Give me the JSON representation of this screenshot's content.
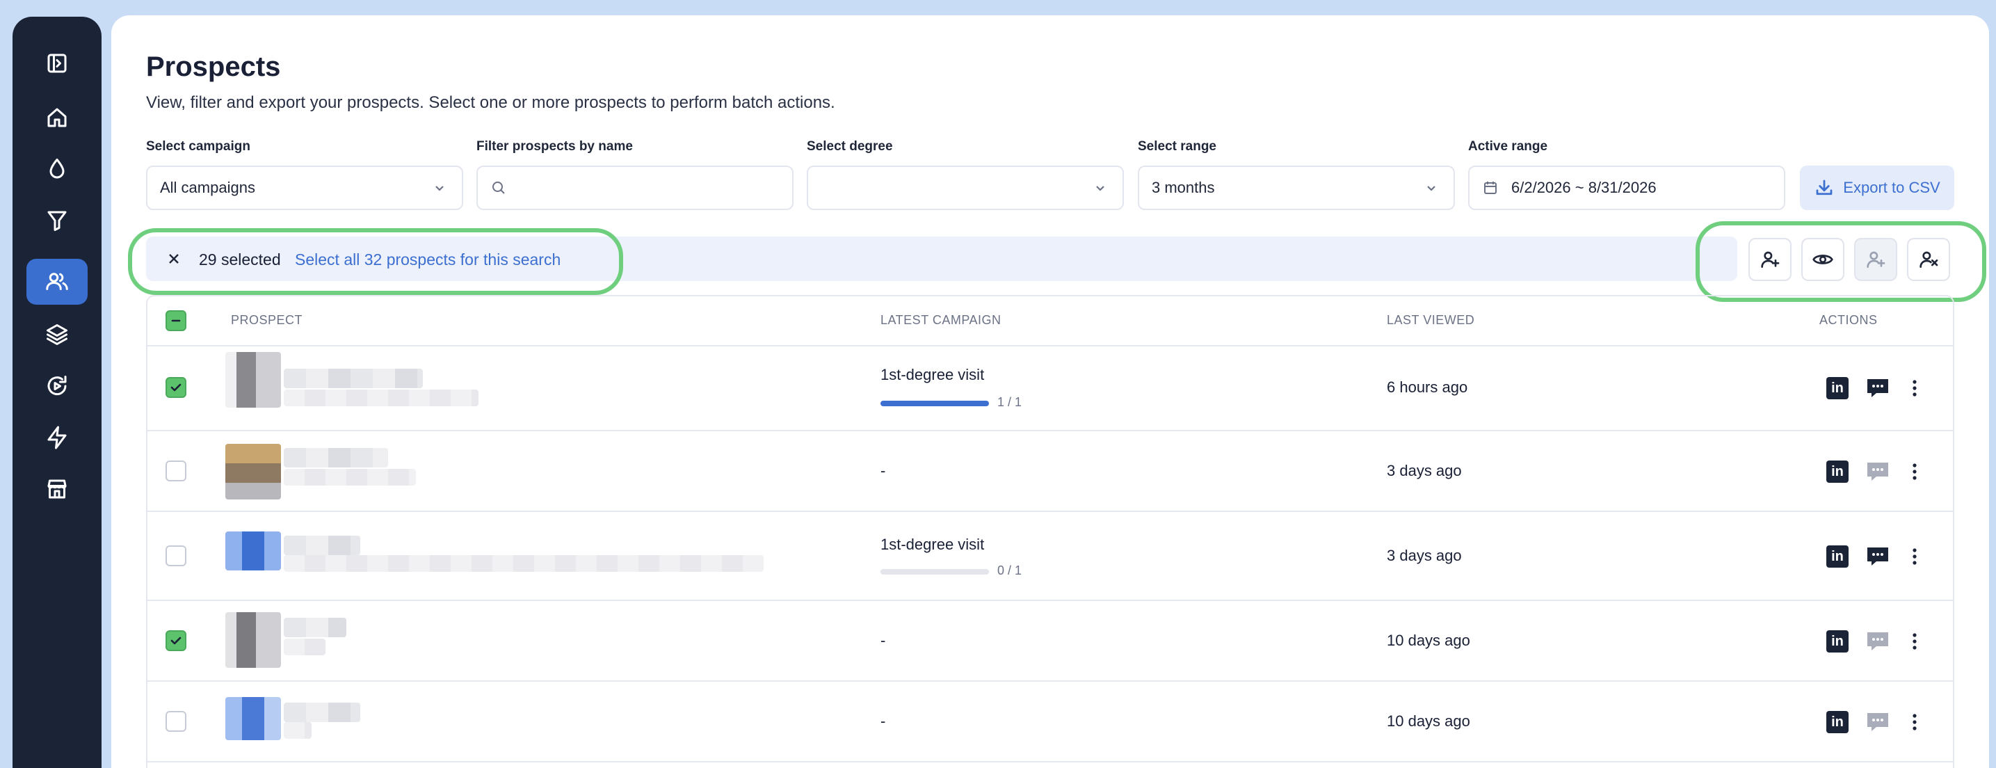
{
  "sidebar": {
    "items": [
      {
        "name": "sidebar-toggle",
        "icon": "panel-toggle-icon"
      },
      {
        "name": "home",
        "icon": "home-icon"
      },
      {
        "name": "drop",
        "icon": "drop-icon"
      },
      {
        "name": "funnel",
        "icon": "funnel-icon"
      },
      {
        "name": "prospects",
        "icon": "users-icon",
        "active": true
      },
      {
        "name": "layers",
        "icon": "layers-icon"
      },
      {
        "name": "refresh",
        "icon": "refresh-icon"
      },
      {
        "name": "bolt",
        "icon": "bolt-icon"
      },
      {
        "name": "store",
        "icon": "store-icon"
      }
    ]
  },
  "page": {
    "title": "Prospects",
    "subtitle": "View, filter and export your prospects. Select one or more prospects to perform batch actions."
  },
  "filters": {
    "campaign": {
      "label": "Select campaign",
      "value": "All campaigns"
    },
    "name": {
      "label": "Filter prospects by name",
      "value": ""
    },
    "degree": {
      "label": "Select degree",
      "value": ""
    },
    "range": {
      "label": "Select range",
      "value": "3 months"
    },
    "active_range": {
      "label": "Active range",
      "value": "6/2/2026 ~ 8/31/2026"
    },
    "export_label": "Export to CSV"
  },
  "selection": {
    "count_text": "29 selected",
    "select_all_text": "Select all 32 prospects for this search",
    "actions": [
      {
        "name": "add-user-button",
        "icon": "user-plus-icon",
        "disabled": false
      },
      {
        "name": "view-button",
        "icon": "eye-icon",
        "disabled": false
      },
      {
        "name": "add-user-disabled-button",
        "icon": "user-plus-icon",
        "disabled": true
      },
      {
        "name": "remove-user-button",
        "icon": "user-x-icon",
        "disabled": false
      }
    ]
  },
  "table": {
    "headers": {
      "prospect": "PROSPECT",
      "latest_campaign": "LATEST CAMPAIGN",
      "last_viewed": "LAST VIEWED",
      "actions": "ACTIONS"
    },
    "rows": [
      {
        "checked": true,
        "campaign": "1st-degree visit",
        "progress": "1 / 1",
        "progress_fraction": 1.0,
        "last_viewed": "6 hours ago",
        "message_active": true
      },
      {
        "checked": false,
        "campaign": "-",
        "progress": "",
        "progress_fraction": null,
        "last_viewed": "3 days ago",
        "message_active": false
      },
      {
        "checked": false,
        "campaign": "1st-degree visit",
        "progress": "0 / 1",
        "progress_fraction": 0.0,
        "last_viewed": "3 days ago",
        "message_active": true
      },
      {
        "checked": true,
        "campaign": "-",
        "progress": "",
        "progress_fraction": null,
        "last_viewed": "10 days ago",
        "message_active": false
      },
      {
        "checked": false,
        "campaign": "-",
        "progress": "",
        "progress_fraction": null,
        "last_viewed": "10 days ago",
        "message_active": false
      }
    ]
  },
  "colors": {
    "accent": "#3c6fd0",
    "sidebar": "#1b2337",
    "check": "#5cc26b",
    "highlight": "#6fcf7f"
  }
}
